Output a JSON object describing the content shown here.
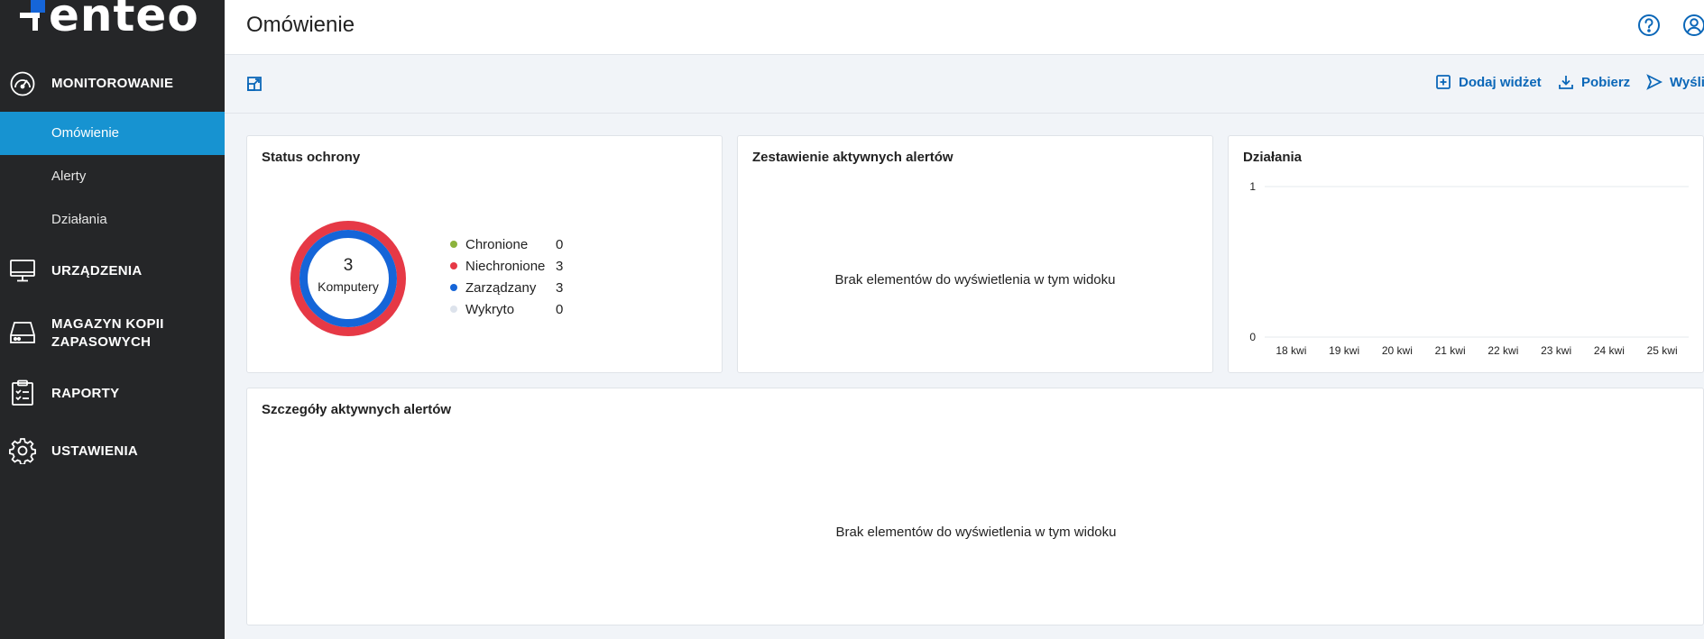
{
  "logo": {
    "text": "enteo"
  },
  "sidebar": {
    "sections": [
      {
        "label": "MONITOROWANIE",
        "icon": "speedometer-icon"
      },
      {
        "label": "URZĄDZENIA",
        "icon": "monitor-icon"
      },
      {
        "label": "MAGAZYN KOPII",
        "label2": "ZAPASOWYCH",
        "icon": "storage-icon"
      },
      {
        "label": "RAPORTY",
        "icon": "clipboard-icon"
      },
      {
        "label": "USTAWIENIA",
        "icon": "gear-icon"
      }
    ],
    "monitoring_items": [
      {
        "label": "Omówienie",
        "active": true
      },
      {
        "label": "Alerty",
        "active": false
      },
      {
        "label": "Działania",
        "active": false
      }
    ]
  },
  "header": {
    "title": "Omówienie",
    "icons": [
      "help-icon",
      "user-icon"
    ]
  },
  "toolbar": {
    "add_widget": "Dodaj widżet",
    "download": "Pobierz",
    "send": "Wyślij"
  },
  "cards": {
    "protection": {
      "title": "Status ochrony",
      "center_value": "3",
      "center_label": "Komputery",
      "legend": [
        {
          "name": "Chronione",
          "value": "0",
          "color": "#8cb33c"
        },
        {
          "name": "Niechronione",
          "value": "3",
          "color": "#e63946"
        },
        {
          "name": "Zarządzany",
          "value": "3",
          "color": "#1565d8"
        },
        {
          "name": "Wykryto",
          "value": "0",
          "color": "#dde3ec"
        }
      ]
    },
    "alert_summary": {
      "title": "Zestawienie aktywnych alertów",
      "empty": "Brak elementów do wyświetlenia w tym widoku"
    },
    "activities": {
      "title": "Działania",
      "chart_data": {
        "type": "line",
        "title": "",
        "categories": [
          "18 kwi",
          "19 kwi",
          "20 kwi",
          "21 kwi",
          "22 kwi",
          "23 kwi",
          "24 kwi",
          "25 kwi"
        ],
        "series": [],
        "yticks": [
          "1",
          "0"
        ],
        "ylim": [
          0,
          1
        ],
        "grid": true
      }
    },
    "alert_details": {
      "title": "Szczegóły aktywnych alertów",
      "empty": "Brak elementów do wyświetlenia w tym widoku"
    }
  },
  "colors": {
    "accent": "#1793d1",
    "link": "#0b67b8",
    "sidebar": "#252628"
  }
}
